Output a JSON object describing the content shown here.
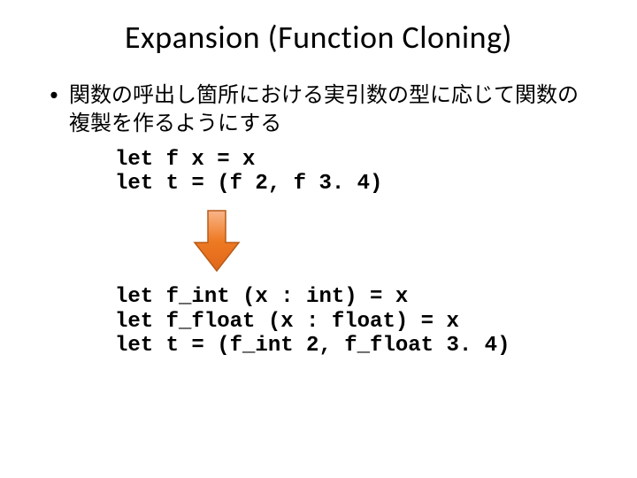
{
  "title": "Expansion (Function Cloning)",
  "bullet1": "関数の呼出し箇所における実引数の型に応じて関数の複製を作るようにする",
  "code1_l1": "let f x = x",
  "code1_l2": "let t = (f 2, f 3. 4)",
  "code2_l1": "let f_int (x : int) = x",
  "code2_l2": "let f_float (x : float) = x",
  "code2_l3": "let t = (f_int 2, f_float 3. 4)"
}
